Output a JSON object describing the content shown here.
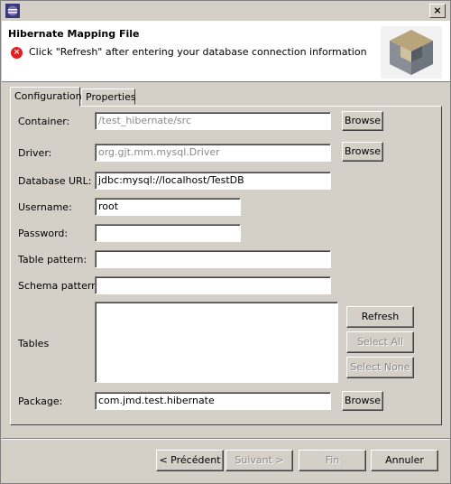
{
  "window": {
    "title": ""
  },
  "banner": {
    "title": "Hibernate Mapping File",
    "message": "Click \"Refresh\" after entering your database connection information"
  },
  "tabs": [
    {
      "label": "Configuration",
      "active": true
    },
    {
      "label": "Properties",
      "active": false
    }
  ],
  "form": {
    "container": {
      "label": "Container:",
      "value": "/test_hibernate/src",
      "enabled": false
    },
    "driver": {
      "label": "Driver:",
      "value": "org.gjt.mm.mysql.Driver",
      "enabled": false
    },
    "database_url": {
      "label": "Database URL:",
      "value": "jdbc:mysql://localhost/TestDB"
    },
    "username": {
      "label": "Username:",
      "value": "root"
    },
    "password": {
      "label": "Password:",
      "value": ""
    },
    "table_pattern": {
      "label": "Table pattern:",
      "value": ""
    },
    "schema_pattern": {
      "label": "Schema pattern:",
      "value": ""
    },
    "tables": {
      "label": "Tables"
    },
    "package": {
      "label": "Package:",
      "value": "com.jmd.test.hibernate"
    }
  },
  "buttons": {
    "browse": "Browse",
    "refresh": "Refresh",
    "select_all": "Select All",
    "select_none": "Select None",
    "back": "< Précédent",
    "next": "Suivant >",
    "finish": "Fin",
    "cancel": "Annuler"
  },
  "colors": {
    "error": "#e02020",
    "disabled_text": "#8a8a8a",
    "face": "#d4d0c8"
  }
}
